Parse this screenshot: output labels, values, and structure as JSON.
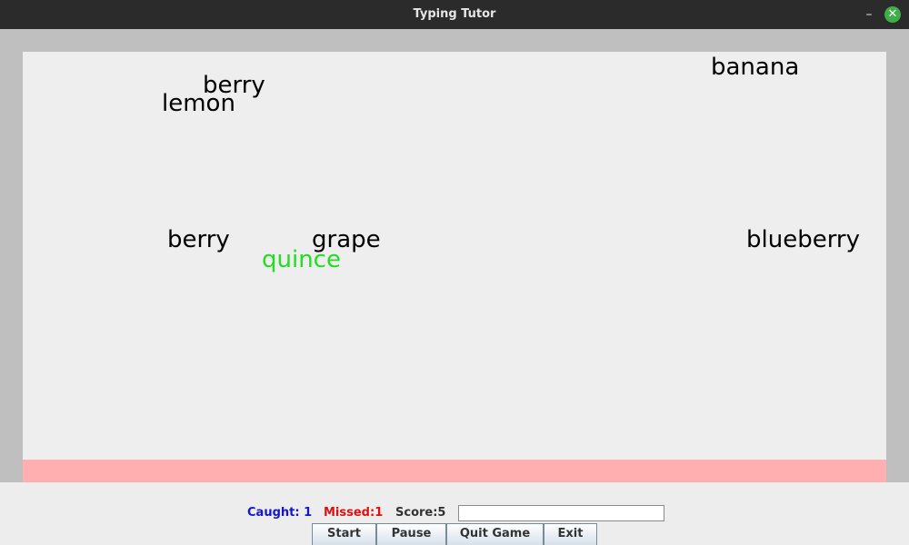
{
  "window": {
    "title": "Typing Tutor",
    "minimize_glyph": "–",
    "close_glyph": "✕"
  },
  "game": {
    "words": [
      {
        "text": "banana",
        "state": "falling"
      },
      {
        "text": "berry",
        "state": "falling"
      },
      {
        "text": "lemon",
        "state": "falling"
      },
      {
        "text": "berry",
        "state": "falling"
      },
      {
        "text": "grape",
        "state": "falling"
      },
      {
        "text": "quince",
        "state": "matched"
      },
      {
        "text": "blueberry",
        "state": "falling"
      }
    ]
  },
  "status": {
    "caught": "Caught: 1",
    "missed": "Missed:1",
    "score": "Score:5"
  },
  "input": {
    "value": ""
  },
  "buttons": {
    "start": "Start",
    "pause": "Pause",
    "quit_game": "Quit Game",
    "exit": "Exit"
  },
  "colors": {
    "caught": "#1515cc",
    "missed": "#dd1111",
    "score": "#333333",
    "active_word": "#22dd22",
    "danger_zone": "#ffafaf"
  }
}
